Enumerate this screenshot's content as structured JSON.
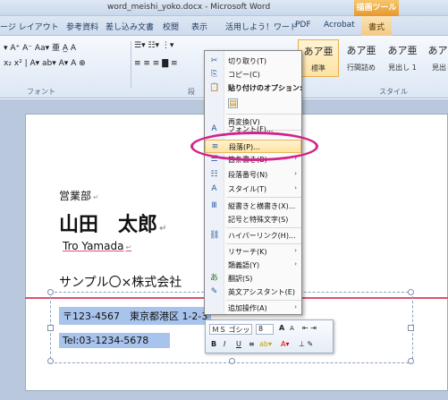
{
  "window": {
    "title": "word_meishi_yoko.docx - Microsoft Word",
    "context_tab_group": "描画ツール"
  },
  "ribbon_tabs": [
    "ージ レイアウト",
    "参考資料",
    "差し込み文書",
    "校閲",
    "表示",
    "活用しよう！ワード",
    "PDF",
    "Acrobat",
    "書式"
  ],
  "ribbon": {
    "font_group_label": "フォント",
    "paragraph_group_label": "段",
    "style_group_label": "スタイル",
    "styles": [
      {
        "sample": "あア亜",
        "name": "標準"
      },
      {
        "sample": "あア亜",
        "name": "行間詰め"
      },
      {
        "sample": "あア亜",
        "name": "見出し 1"
      },
      {
        "sample": "あア亜",
        "name": "見出し"
      }
    ]
  },
  "document": {
    "department": "営業部",
    "name_jp": "山田　太郎",
    "name_en": "Tro Yamada",
    "company": "サンプル〇×株式会社",
    "address": "〒123-4567　東京都港区 1-2-3",
    "tel": "Tel:03-1234-5678"
  },
  "context_menu": {
    "items": [
      {
        "icon": "cut-icon",
        "glyph": "✂",
        "label": "切り取り(T)"
      },
      {
        "icon": "copy-icon",
        "glyph": "⎘",
        "label": "コピー(C)"
      },
      {
        "icon": "paste-options-icon",
        "glyph": "📋",
        "label": "貼り付けのオプション:"
      },
      {
        "icon": "paste-icon",
        "glyph": "▤",
        "label": ""
      },
      {
        "icon": "",
        "glyph": "",
        "label": "再変換(V)"
      },
      {
        "icon": "font-icon",
        "glyph": "A",
        "label": "フォント(F)..."
      },
      {
        "icon": "paragraph-icon",
        "glyph": "≡",
        "label": "段落(P)..."
      },
      {
        "icon": "bullets-icon",
        "glyph": "☰",
        "label": "箇条書き(B)"
      },
      {
        "icon": "numbering-icon",
        "glyph": "☷",
        "label": "段落番号(N)"
      },
      {
        "icon": "styles-icon",
        "glyph": "A",
        "label": "スタイル(T)"
      },
      {
        "icon": "vertical-text-icon",
        "glyph": "Ⅲ",
        "label": "縦書きと横書き(X)..."
      },
      {
        "icon": "",
        "glyph": "",
        "label": "記号と特殊文字(S)"
      },
      {
        "icon": "hyperlink-icon",
        "glyph": "⛓",
        "label": "ハイパーリンク(H)..."
      },
      {
        "icon": "",
        "glyph": "",
        "label": "リサーチ(K)"
      },
      {
        "icon": "",
        "glyph": "",
        "label": "類義語(Y)"
      },
      {
        "icon": "translate-icon",
        "glyph": "あ",
        "label": "翻訳(S)"
      },
      {
        "icon": "english-assistant-icon",
        "glyph": "✎",
        "label": "英文アシスタント(E)"
      },
      {
        "icon": "",
        "glyph": "",
        "label": "追加操作(A)"
      }
    ]
  },
  "mini_toolbar": {
    "font": "ＭＳ ゴシッ",
    "size": "8",
    "grow": "A",
    "shrink": "A",
    "bold": "B",
    "italic": "I",
    "underline": "U"
  },
  "colors": {
    "highlight_oval": "#d2238a",
    "selection": "#a8c4ec",
    "margin_line": "#e0506f"
  }
}
